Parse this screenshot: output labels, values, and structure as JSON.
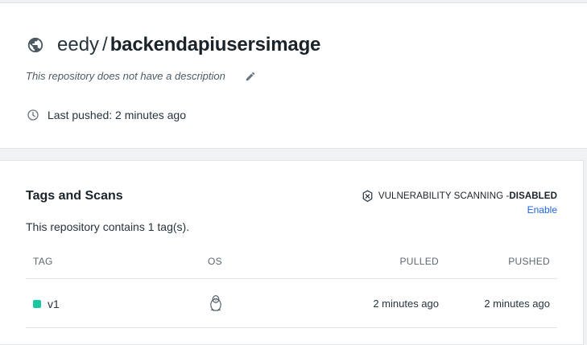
{
  "repo": {
    "namespace": "eedy",
    "separator": "/",
    "name": "backendapiusersimage",
    "description": "This repository does not have a description",
    "last_pushed": "Last pushed: 2 minutes ago"
  },
  "tags_section": {
    "title": "Tags and Scans",
    "vuln_label": "VULNERABILITY SCANNING - ",
    "vuln_status": "DISABLED",
    "enable_label": "Enable",
    "tag_count_text": "This repository contains 1 tag(s).",
    "columns": {
      "tag": "TAG",
      "os": "OS",
      "pulled": "PULLED",
      "pushed": "PUSHED"
    },
    "rows": [
      {
        "tag": "v1",
        "os_icon": "linux-tux-icon",
        "pulled": "2 minutes ago",
        "pushed": "2 minutes ago",
        "status_color": "#18c8a0"
      }
    ]
  },
  "colors": {
    "link": "#1d63ed",
    "tag_dot": "#18c8a0",
    "text": "#27343d"
  }
}
